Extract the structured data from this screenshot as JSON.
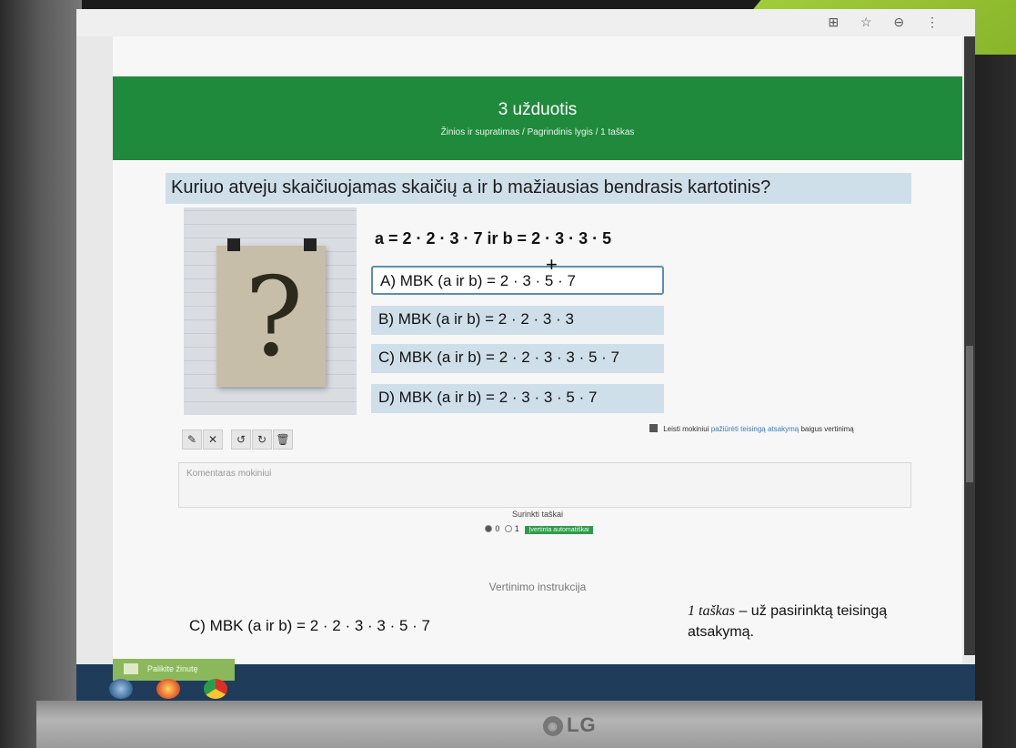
{
  "monitor": {
    "brand": "LG"
  },
  "browser": {
    "toolbar_icons": "⊞ ☆ ⊖ ⋮"
  },
  "header": {
    "title": "3 užduotis",
    "subtitle": "Žinios ir supratimas / Pagrindinis lygis / 1 taškas"
  },
  "question": {
    "text": "Kuriuo atveju skaičiuojamas skaičių a ir b mažiausias bendrasis kartotinis?",
    "formula": "a = 2 · 2 · 3 · 7 ir b = 2 · 3 · 3 · 5",
    "image_icon": "question-mark-poster"
  },
  "options": [
    {
      "label": "A) MBK (a ir b) = 2 · 3 · 5 · 7",
      "selected": true
    },
    {
      "label": "B) MBK (a ir b) = 2 · 2 · 3 · 3",
      "selected": false
    },
    {
      "label": "C) MBK (a ir b) = 2 · 2 · 3 · 3 · 5 · 7",
      "selected": false
    },
    {
      "label": "D) MBK (a ir b) = 2 · 3 · 3 · 5 · 7",
      "selected": false
    }
  ],
  "toolbar": {
    "edit": "✎",
    "clear": "✕",
    "undo": "↺",
    "redo": "↻",
    "delete": "🗑"
  },
  "allow_view": {
    "prefix": "Leisti mokiniui",
    "link": "pažiūrėti teisingą atsakymą",
    "suffix": "baigus vertinimą"
  },
  "comment": {
    "placeholder": "Komentaras mokiniui"
  },
  "points": {
    "title": "Surinkti taškai",
    "option0": "0",
    "option1": "1",
    "badge": "Įvertinta automatiškai",
    "selected": 0
  },
  "instructions": {
    "title": "Vertinimo instrukcija",
    "answer": "C) MBK (a ir b) = 2 · 2 · 3 · 3 · 5 · 7",
    "points_em": "1 taškas",
    "points_text": " – už pasirinktą teisingą atsakymą."
  },
  "taskbar": {
    "button": "Palikite žinutę"
  }
}
